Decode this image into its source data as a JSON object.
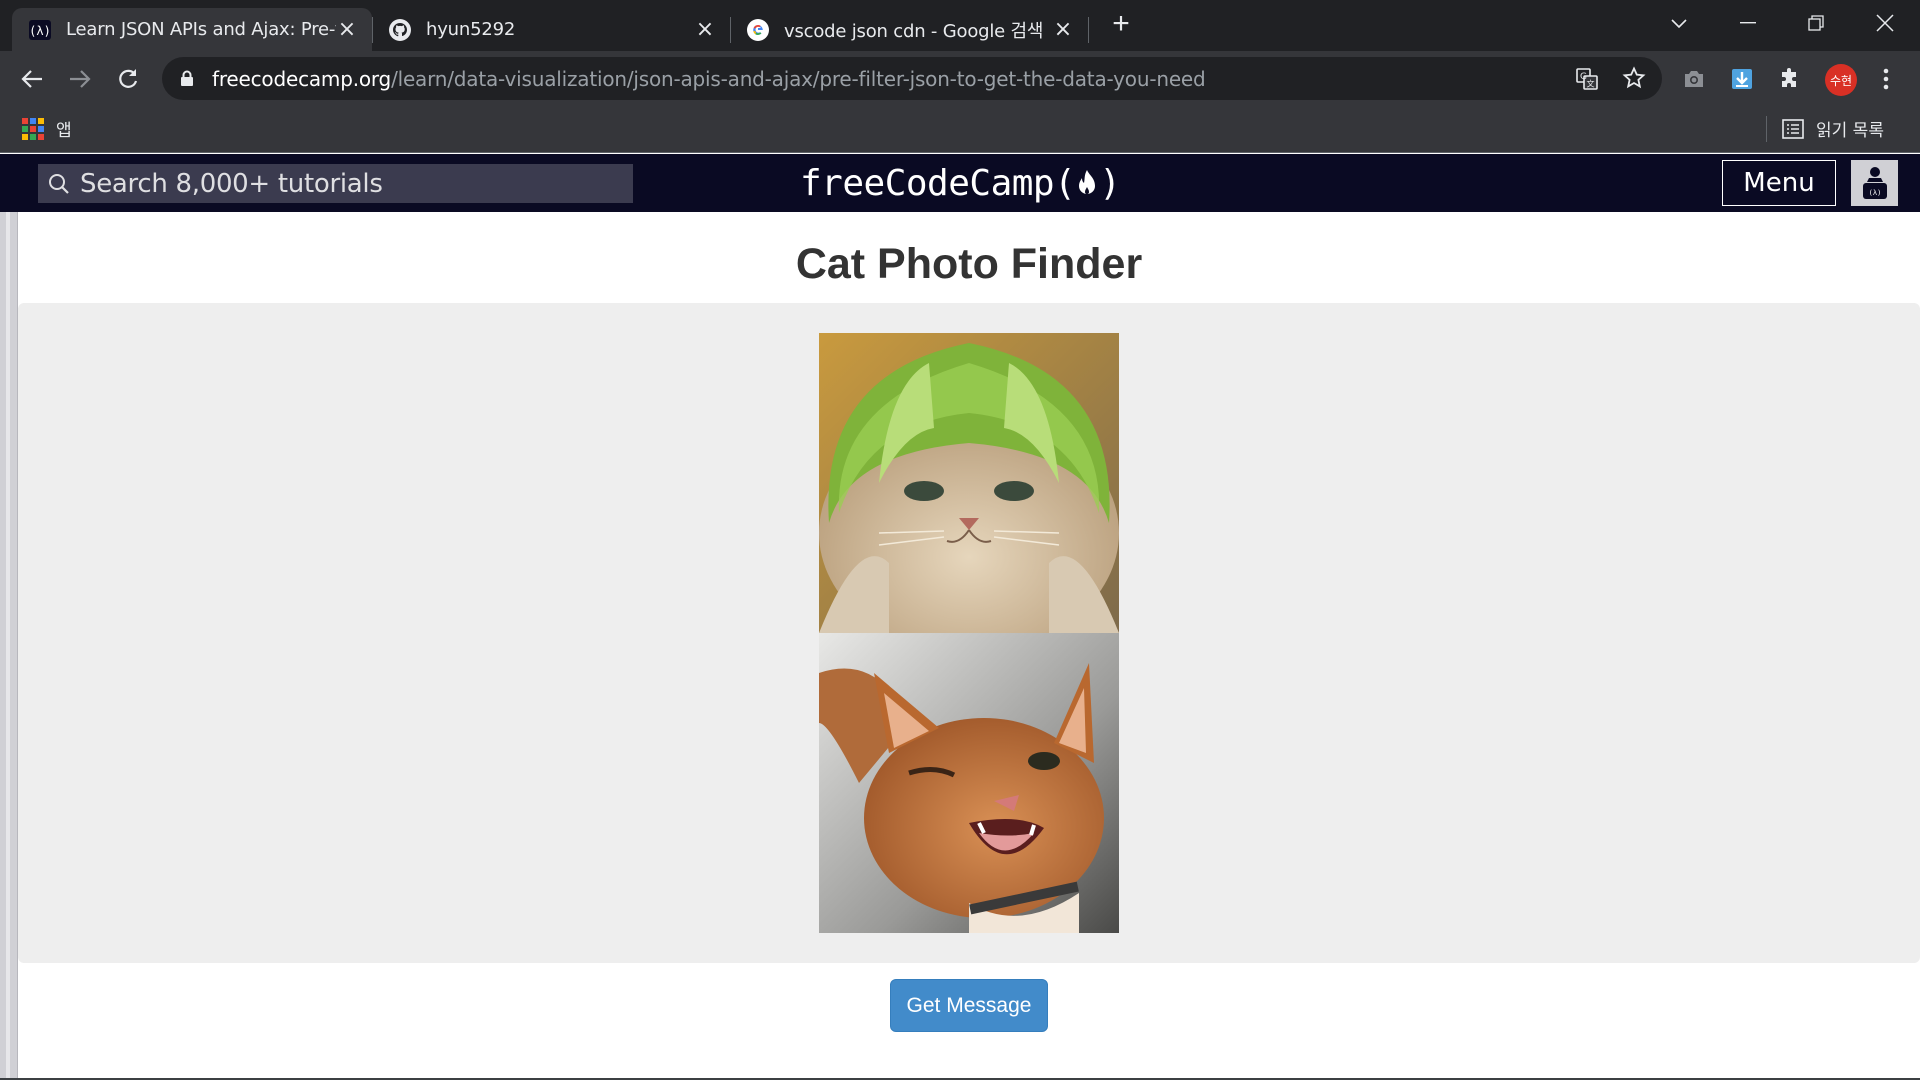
{
  "browser": {
    "tabs": [
      {
        "title": "Learn JSON APIs and Ajax: Pre-f",
        "favicon": "freecodecamp-icon",
        "active": true
      },
      {
        "title": "hyun5292",
        "favicon": "github-icon",
        "active": false
      },
      {
        "title": "vscode json cdn - Google 검색",
        "favicon": "google-icon",
        "active": false
      }
    ],
    "url_host": "freecodecamp.org",
    "url_path": "/learn/data-visualization/json-apis-and-ajax/pre-filter-json-to-get-the-data-you-need",
    "profile_label": "수현",
    "bookmarks": {
      "apps_label": "앱",
      "reading_list_label": "읽기 목록"
    }
  },
  "fcc": {
    "search_placeholder": "Search 8,000+ tutorials",
    "logo_text": "freeCodeCamp(",
    "logo_close": ")",
    "menu_label": "Menu"
  },
  "preview": {
    "heading": "Cat Photo Finder",
    "images": [
      {
        "icon": "cat-with-melon-helmet-image"
      },
      {
        "icon": "winking-ginger-cat-image"
      }
    ],
    "button_label": "Get Message",
    "accent_color": "#428bca"
  }
}
